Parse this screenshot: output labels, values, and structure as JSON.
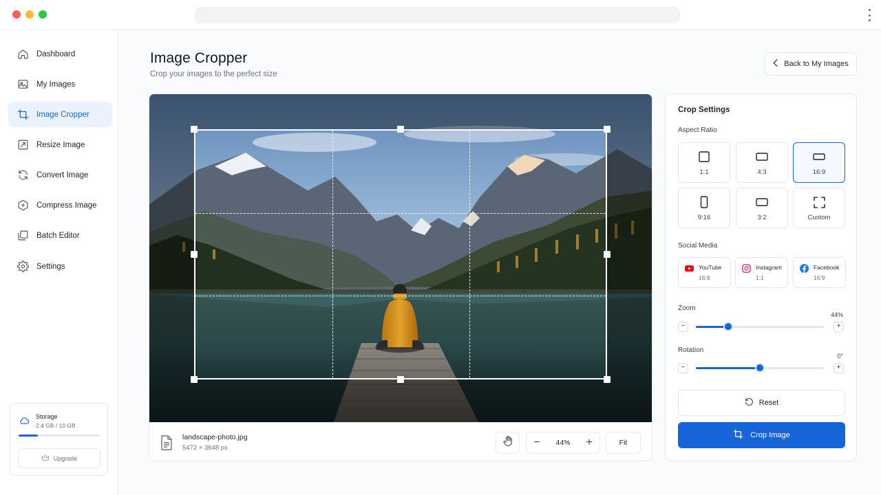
{
  "sidebar": {
    "items": [
      {
        "label": "Dashboard",
        "icon": "home-icon",
        "active": false
      },
      {
        "label": "My Images",
        "icon": "image-icon",
        "active": false
      },
      {
        "label": "Image Cropper",
        "icon": "crop-icon",
        "active": true
      },
      {
        "label": "Resize Image",
        "icon": "resize-icon",
        "active": false
      },
      {
        "label": "Convert Image",
        "icon": "convert-icon",
        "active": false
      },
      {
        "label": "Compress Image",
        "icon": "compress-icon",
        "active": false
      },
      {
        "label": "Batch Editor",
        "icon": "layers-icon",
        "active": false
      },
      {
        "label": "Settings",
        "icon": "gear-icon",
        "active": false
      }
    ],
    "storage": {
      "title": "Storage",
      "usage": "2.4 GB / 10 GB",
      "used_fraction": 0.24,
      "upgrade_label": "Upgrade"
    }
  },
  "header": {
    "title": "Image Cropper",
    "subtitle": "Crop your images to the perfect size",
    "back_label": "Back to My Images"
  },
  "editor": {
    "file_name": "landscape-photo.jpg",
    "file_dims": "5472 × 3648 px",
    "zoom_value": "44%",
    "fit_label": "Fit"
  },
  "settings": {
    "title": "Crop Settings",
    "aspect_label": "Aspect Ratio",
    "ratios": [
      {
        "label": "1:1",
        "icon": "square-icon",
        "selected": false
      },
      {
        "label": "4:3",
        "icon": "landscape-rect-icon",
        "selected": false
      },
      {
        "label": "16:9",
        "icon": "wide-rect-icon",
        "selected": true
      },
      {
        "label": "9:16",
        "icon": "portrait-rect-icon",
        "selected": false
      },
      {
        "label": "3:2",
        "icon": "landscape-rect-icon",
        "selected": false
      },
      {
        "label": "Custom",
        "icon": "custom-frame-icon",
        "selected": false
      }
    ],
    "social_label": "Social Media",
    "social": [
      {
        "name": "YouTube",
        "ratio": "16:9",
        "icon": "youtube-icon",
        "color": "#ff0000"
      },
      {
        "name": "Instagram",
        "ratio": "1:1",
        "icon": "instagram-icon",
        "color": "#d62976"
      },
      {
        "name": "Facebook",
        "ratio": "16:9",
        "icon": "facebook-icon",
        "color": "#1877f2"
      }
    ],
    "zoom_label": "Zoom",
    "zoom_value": "44%",
    "zoom_fraction": 0.25,
    "rotation_label": "Rotation",
    "rotation_value": "0°",
    "rotation_fraction": 0.5,
    "reset_label": "Reset",
    "crop_label": "Crop Image"
  },
  "colors": {
    "accent": "#1565d8",
    "active_bg": "#eaf2fd"
  }
}
